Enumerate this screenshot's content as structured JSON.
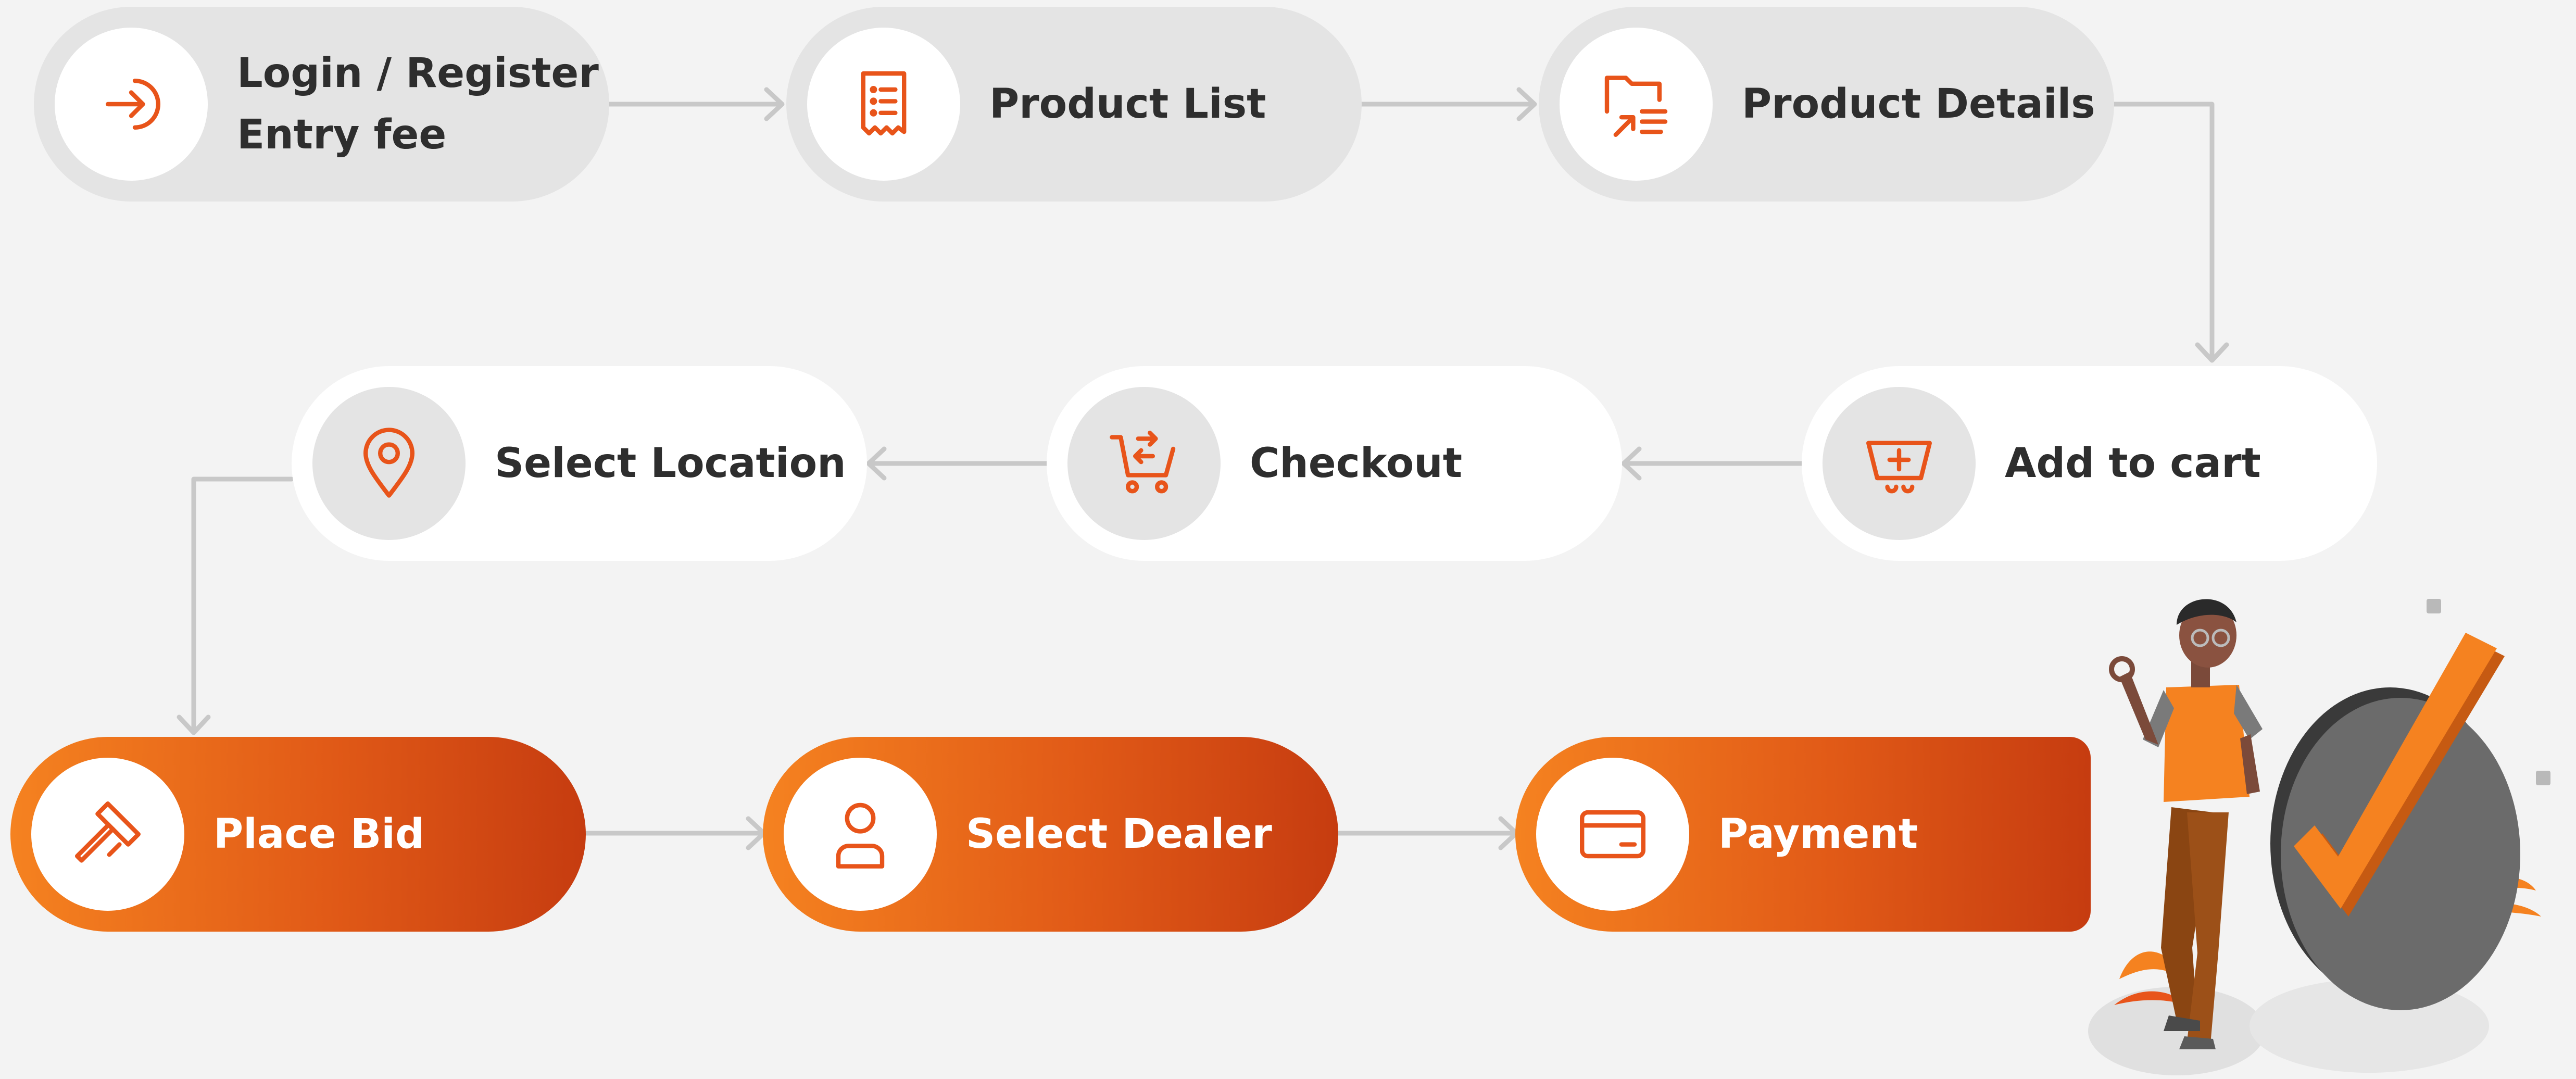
{
  "colors": {
    "background": "#f3f3f3",
    "node_gray": "#e4e4e4",
    "node_white": "#ffffff",
    "accent": "#e8541a",
    "accent_light": "#f58220",
    "accent_dark": "#c63c10",
    "text": "#2e2e2e",
    "connector": "#c8c8c8"
  },
  "steps": [
    {
      "id": "login",
      "label_line1": "Login / Register",
      "label_line2": "Entry fee",
      "icon": "login-arrow-icon"
    },
    {
      "id": "product-list",
      "label": "Product List",
      "icon": "receipt-list-icon"
    },
    {
      "id": "product-details",
      "label": "Product Details",
      "icon": "folder-details-icon"
    },
    {
      "id": "add-to-cart",
      "label": "Add to cart",
      "icon": "basket-plus-icon"
    },
    {
      "id": "checkout",
      "label": "Checkout",
      "icon": "cart-arrow-icon"
    },
    {
      "id": "select-location",
      "label": "Select Location",
      "icon": "location-pin-icon"
    },
    {
      "id": "place-bid",
      "label": "Place Bid",
      "icon": "gavel-icon"
    },
    {
      "id": "select-dealer",
      "label": "Select Dealer",
      "icon": "user-icon"
    },
    {
      "id": "payment",
      "label": "Payment",
      "icon": "credit-card-icon"
    }
  ],
  "illustration": {
    "icon": "person-with-checkmark-illustration"
  }
}
